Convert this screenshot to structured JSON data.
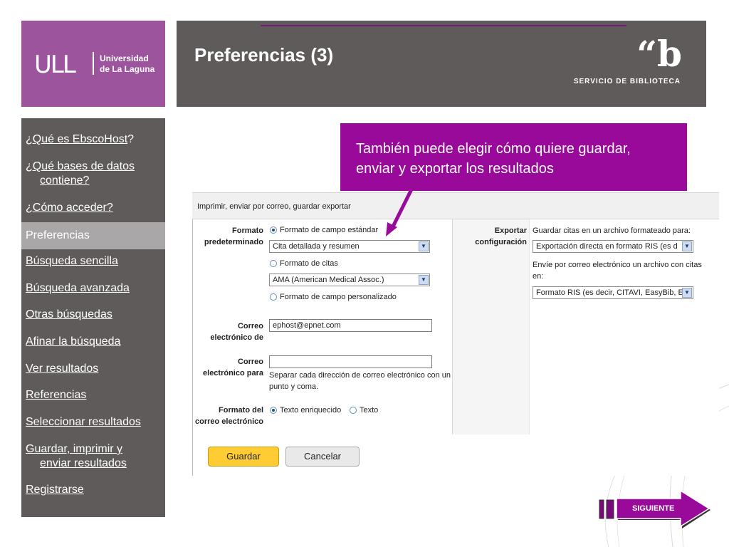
{
  "header": {
    "logo_mark": "ULL",
    "logo_line1": "Universidad",
    "logo_line2": "de La Laguna",
    "page_title": "Preferencias (3)",
    "library_mark": "“b",
    "library_name": "SERVICIO DE BIBLIOTECA"
  },
  "sidebar": {
    "items": [
      {
        "label": "¿Qué es EbscoHost",
        "suffix": "?"
      },
      {
        "label_line1": "¿Qué bases de datos",
        "label_line2": "contiene?"
      },
      {
        "label": "¿Cómo acceder?"
      },
      {
        "label": "Preferencias",
        "active": true
      },
      {
        "label": "Búsqueda sencilla"
      },
      {
        "label": "Búsqueda avanzada"
      },
      {
        "label": "Otras búsquedas"
      },
      {
        "label": "Afinar la búsqueda"
      },
      {
        "label": "Ver resultados"
      },
      {
        "label": "Referencias"
      },
      {
        "label": "Seleccionar resultados"
      },
      {
        "label_line1": "Guardar, imprimir y",
        "label_line2": "enviar resultados"
      },
      {
        "label": "Registrarse"
      }
    ]
  },
  "callout": {
    "line1": "También puede elegir cómo quiere guardar,",
    "line2": "enviar y exportar los resultados"
  },
  "form": {
    "header": "Imprimir, enviar por correo, guardar exportar",
    "format_label_1": "Formato",
    "format_label_2": "predeterminado",
    "radio_standard": "Formato de campo estándar",
    "select_standard": "Cita detallada y resumen",
    "radio_citation": "Formato de citas",
    "select_citation": "AMA (American Medical Assoc.)",
    "radio_custom": "Formato de campo personalizado",
    "from_label_1": "Correo",
    "from_label_2": "electrónico de",
    "from_value": "ephost@epnet.com",
    "to_label_1": "Correo",
    "to_label_2": "electrónico para",
    "to_value": "",
    "to_help_1": "Separar cada dirección de correo electrónico con un",
    "to_help_2": "punto y coma.",
    "mailfmt_label_1": "Formato del",
    "mailfmt_label_2": "correo electrónico",
    "radio_rich": "Texto enriquecido",
    "radio_plain": "Texto",
    "export_label_1": "Exportar",
    "export_label_2": "configuración",
    "export_help": "Guardar citas en un archivo formateado para:",
    "export_select": "Exportación directa en formato RIS (es d",
    "email_help_1": "Envíe por correo electrónico un archivo con citas",
    "email_help_2": "en:",
    "email_select": "Formato RIS (es decir, CITAVI, EasyBib, E",
    "save_button": "Guardar",
    "cancel_button": "Cancelar"
  },
  "next_button": "SIGUIENTE",
  "colors": {
    "purple": "#9c549c",
    "callout_purple": "#9a0a9a",
    "dark_gray": "#5f5b5b",
    "active_gray": "#a9a7a7",
    "save_yellow": "#ffcc33"
  }
}
